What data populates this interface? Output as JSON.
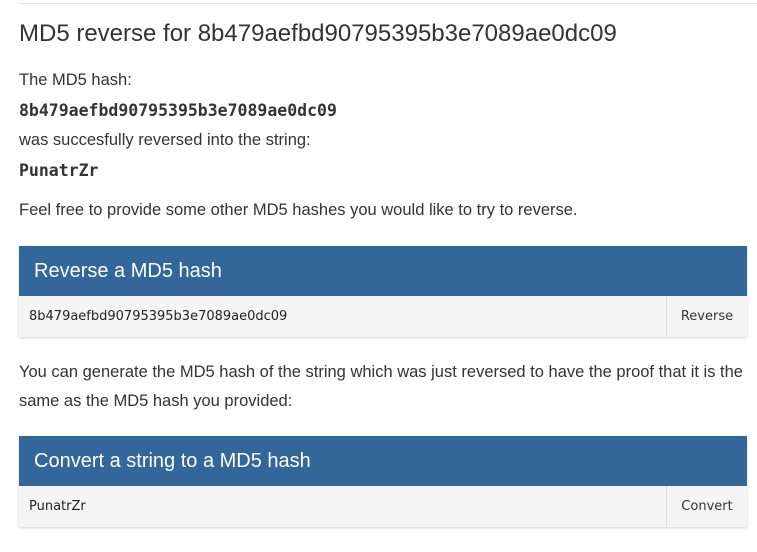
{
  "title": "MD5 reverse for 8b479aefbd90795395b3e7089ae0dc09",
  "result": {
    "hash_label": "The MD5 hash:",
    "hash_value": "8b479aefbd90795395b3e7089ae0dc09",
    "reversed_label": "was succesfully reversed into the string:",
    "reversed_value": "PunatrZr"
  },
  "invite_text": "Feel free to provide some other MD5 hashes you would like to try to reverse.",
  "reverse_panel": {
    "heading": "Reverse a MD5 hash",
    "input_value": "8b479aefbd90795395b3e7089ae0dc09",
    "button_label": "Reverse"
  },
  "generate_text": "You can generate the MD5 hash of the string which was just reversed to have the proof that it is the same as the MD5 hash you provided:",
  "convert_panel": {
    "heading": "Convert a string to a MD5 hash",
    "input_value": "PunatrZr",
    "button_label": "Convert"
  },
  "colors": {
    "panel_header": "#336699",
    "panel_body": "#f5f5f5",
    "text": "#333333"
  }
}
